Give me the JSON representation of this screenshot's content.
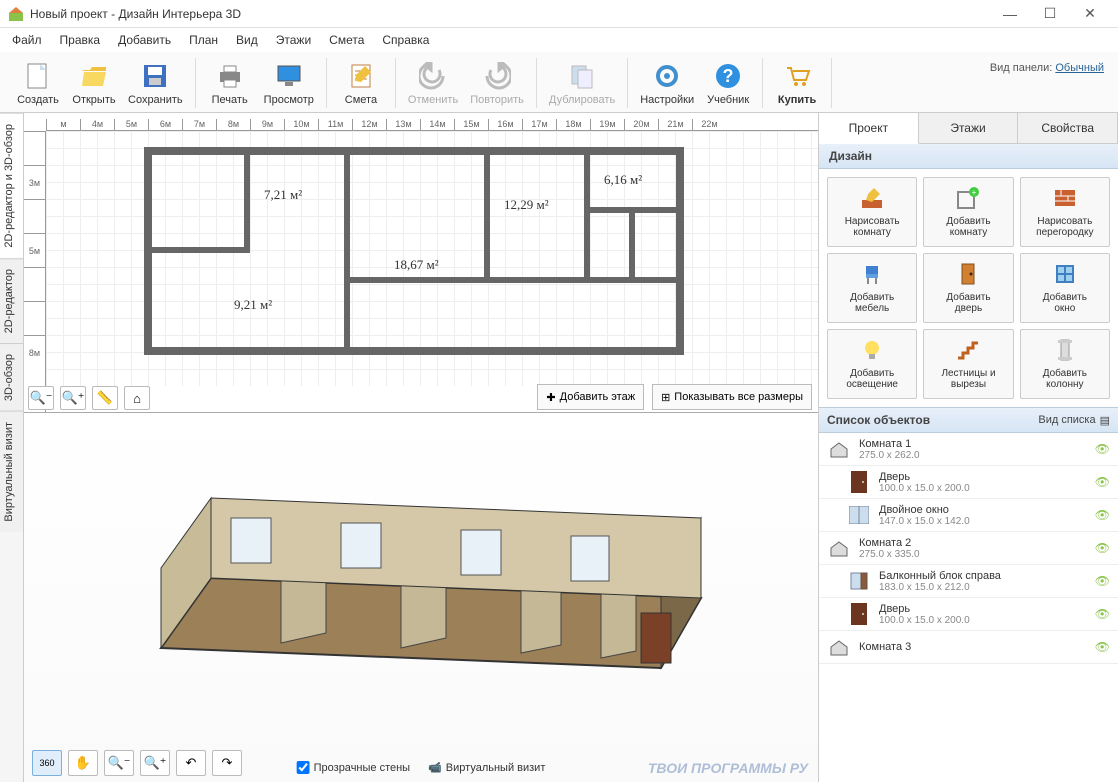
{
  "window": {
    "title": "Новый проект - Дизайн Интерьера 3D"
  },
  "menu": [
    "Файл",
    "Правка",
    "Добавить",
    "План",
    "Вид",
    "Этажи",
    "Смета",
    "Справка"
  ],
  "toolbar": {
    "create": "Создать",
    "open": "Открыть",
    "save": "Сохранить",
    "print": "Печать",
    "preview": "Просмотр",
    "estimate": "Смета",
    "undo": "Отменить",
    "redo": "Повторить",
    "duplicate": "Дублировать",
    "settings": "Настройки",
    "tutorial": "Учебник",
    "buy": "Купить",
    "panel_view_label": "Вид панели:",
    "panel_view_value": "Обычный"
  },
  "side_tabs": {
    "combo": "2D-редактор и 3D-обзор",
    "editor2d": "2D-редактор",
    "view3d": "3D-обзор",
    "vr": "Виртуальный визит"
  },
  "ruler_h": [
    "м",
    "4м",
    "5м",
    "6м",
    "7м",
    "8м",
    "9м",
    "10м",
    "11м",
    "12м",
    "13м",
    "14м",
    "15м",
    "16м",
    "17м",
    "18м",
    "19м",
    "20м",
    "21м",
    "22м"
  ],
  "ruler_v": [
    "",
    "3м",
    "",
    "5м",
    "",
    "",
    "8м"
  ],
  "rooms": {
    "r1": "7,21 м²",
    "r2": "18,67 м²",
    "r3": "12,29 м²",
    "r4": "6,16 м²",
    "r5": "9,21 м²"
  },
  "plan_actions": {
    "add_floor": "Добавить этаж",
    "show_dims": "Показывать все размеры"
  },
  "view3d": {
    "transparent_walls": "Прозрачные стены",
    "camera_view": "Виртуальный визит"
  },
  "right_tabs": {
    "project": "Проект",
    "floors": "Этажи",
    "properties": "Свойства"
  },
  "design_section": "Дизайн",
  "design_buttons": [
    {
      "k": "draw-room",
      "l1": "Нарисовать",
      "l2": "комнату"
    },
    {
      "k": "add-room",
      "l1": "Добавить",
      "l2": "комнату"
    },
    {
      "k": "draw-partition",
      "l1": "Нарисовать",
      "l2": "перегородку"
    },
    {
      "k": "add-furniture",
      "l1": "Добавить",
      "l2": "мебель"
    },
    {
      "k": "add-door",
      "l1": "Добавить",
      "l2": "дверь"
    },
    {
      "k": "add-window",
      "l1": "Добавить",
      "l2": "окно"
    },
    {
      "k": "add-lighting",
      "l1": "Добавить",
      "l2": "освещение"
    },
    {
      "k": "stairs",
      "l1": "Лестницы и",
      "l2": "вырезы"
    },
    {
      "k": "add-column",
      "l1": "Добавить",
      "l2": "колонну"
    }
  ],
  "obj_list_header": "Список объектов",
  "obj_list_view": "Вид списка",
  "objects": [
    {
      "type": "room",
      "name": "Комната 1",
      "dims": "275.0 x 262.0",
      "child": false
    },
    {
      "type": "door",
      "name": "Дверь",
      "dims": "100.0 x 15.0 x 200.0",
      "child": true
    },
    {
      "type": "window2",
      "name": "Двойное окно",
      "dims": "147.0 x 15.0 x 142.0",
      "child": true
    },
    {
      "type": "room",
      "name": "Комната 2",
      "dims": "275.0 x 335.0",
      "child": false
    },
    {
      "type": "balcony",
      "name": "Балконный блок справа",
      "dims": "183.0 x 15.0 x 212.0",
      "child": true
    },
    {
      "type": "door",
      "name": "Дверь",
      "dims": "100.0 x 15.0 x 200.0",
      "child": true
    },
    {
      "type": "room",
      "name": "Комната 3",
      "dims": "",
      "child": false
    }
  ],
  "watermark": "ТВОИ ПРОГРАММЫ РУ"
}
